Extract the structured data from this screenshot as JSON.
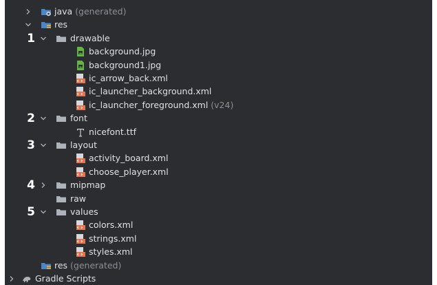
{
  "tree": [
    {
      "label": "java",
      "suffix": "(generated)",
      "icon": "java-generated-folder-icon",
      "expanded": false,
      "level": 0,
      "marker": ""
    },
    {
      "label": "res",
      "suffix": "",
      "icon": "resource-folder-icon",
      "expanded": true,
      "level": 0,
      "marker": ""
    },
    {
      "label": "drawable",
      "suffix": "",
      "icon": "folder-icon",
      "expanded": true,
      "level": 1,
      "marker": "1"
    },
    {
      "label": "background.jpg",
      "suffix": "",
      "icon": "image-file-icon",
      "level": 2,
      "marker": ""
    },
    {
      "label": "background1.jpg",
      "suffix": "",
      "icon": "image-file-icon",
      "level": 2,
      "marker": ""
    },
    {
      "label": "ic_arrow_back.xml",
      "suffix": "",
      "icon": "xml-file-icon",
      "level": 2,
      "marker": ""
    },
    {
      "label": "ic_launcher_background.xml",
      "suffix": "",
      "icon": "xml-file-icon",
      "level": 2,
      "marker": ""
    },
    {
      "label": "ic_launcher_foreground.xml",
      "suffix": "(v24)",
      "icon": "xml-file-icon",
      "level": 2,
      "marker": ""
    },
    {
      "label": "font",
      "suffix": "",
      "icon": "folder-icon",
      "expanded": true,
      "level": 1,
      "marker": "2"
    },
    {
      "label": "nicefont.ttf",
      "suffix": "",
      "icon": "font-file-icon",
      "level": 2,
      "marker": ""
    },
    {
      "label": "layout",
      "suffix": "",
      "icon": "folder-icon",
      "expanded": true,
      "level": 1,
      "marker": "3"
    },
    {
      "label": "activity_board.xml",
      "suffix": "",
      "icon": "xml-file-icon",
      "level": 2,
      "marker": ""
    },
    {
      "label": "choose_player.xml",
      "suffix": "",
      "icon": "xml-file-icon",
      "level": 2,
      "marker": ""
    },
    {
      "label": "mipmap",
      "suffix": "",
      "icon": "folder-icon",
      "expanded": false,
      "level": 1,
      "marker": "4"
    },
    {
      "label": "raw",
      "suffix": "",
      "icon": "folder-icon",
      "level": 1,
      "marker": ""
    },
    {
      "label": "values",
      "suffix": "",
      "icon": "folder-icon",
      "expanded": true,
      "level": 1,
      "marker": "5"
    },
    {
      "label": "colors.xml",
      "suffix": "",
      "icon": "xml-file-icon",
      "level": 2,
      "marker": ""
    },
    {
      "label": "strings.xml",
      "suffix": "",
      "icon": "xml-file-icon",
      "level": 2,
      "marker": ""
    },
    {
      "label": "styles.xml",
      "suffix": "",
      "icon": "xml-file-icon",
      "level": 2,
      "marker": ""
    },
    {
      "label": "res",
      "suffix": "(generated)",
      "icon": "resource-folder-icon",
      "level": 0,
      "marker": ""
    },
    {
      "label": "Gradle Scripts",
      "suffix": "",
      "icon": "gradle-icon",
      "expanded": false,
      "level": -1,
      "marker": ""
    }
  ],
  "colors": {
    "background": "#2b2d30",
    "text": "#dfe1e5",
    "generated_text": "#8c8f94",
    "folder": "#aeb3bb",
    "java_folder": "#4a86c8",
    "image_icon": "#62b543",
    "xml_icon": "#e8744f",
    "resource_badge": "#d9a343"
  }
}
